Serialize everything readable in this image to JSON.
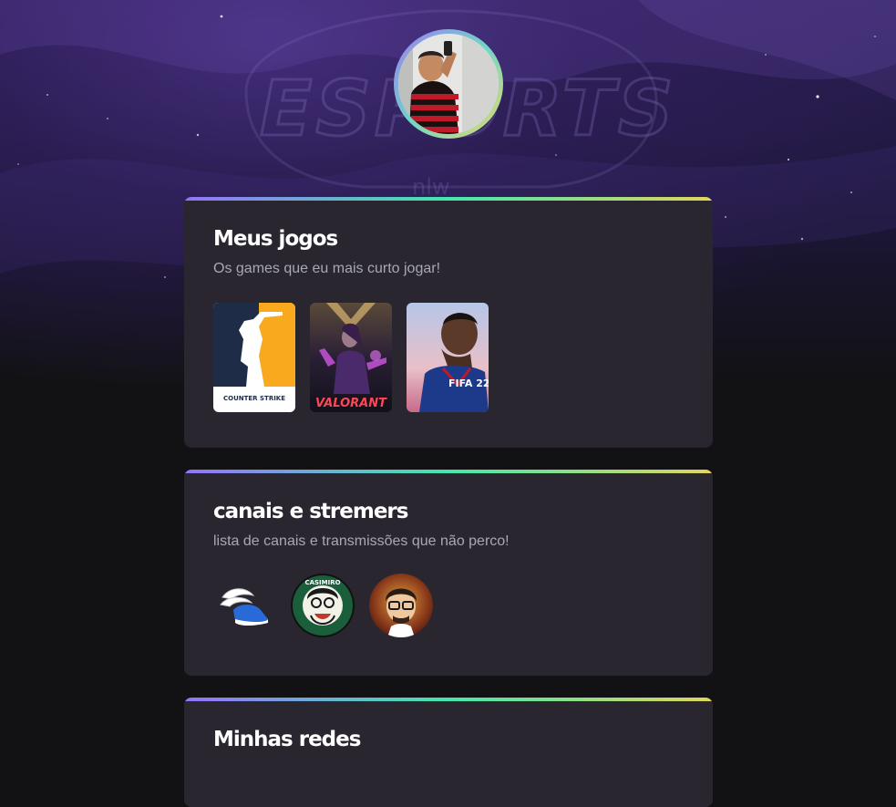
{
  "profile": {
    "avatar_icon": "profile-photo"
  },
  "background": {
    "watermark_text": "ESPORTS",
    "watermark_sub": "nlw"
  },
  "sections": [
    {
      "title": "Meus jogos",
      "description": "Os games que eu mais curto jogar!",
      "games": [
        {
          "name": "Counter-Strike",
          "label": "COUNTER STRIKE"
        },
        {
          "name": "Valorant",
          "label": "VALORANT"
        },
        {
          "name": "FIFA 22",
          "label": "FIFA 22"
        }
      ]
    },
    {
      "title": "canais e stremers",
      "description": "lista de canais e transmissões que não perco!",
      "channels": [
        {
          "name": "winged-shoe-channel"
        },
        {
          "name": "Casimiro",
          "label": "CASIMIRO"
        },
        {
          "name": "streamer-cartoon-avatar"
        }
      ]
    },
    {
      "title": "Minhas redes"
    }
  ],
  "colors": {
    "accent_gradient": [
      "#9572fc",
      "#43e7ad",
      "#e1d55d"
    ],
    "card_bg": "#29262f",
    "page_bg": "#121214"
  }
}
